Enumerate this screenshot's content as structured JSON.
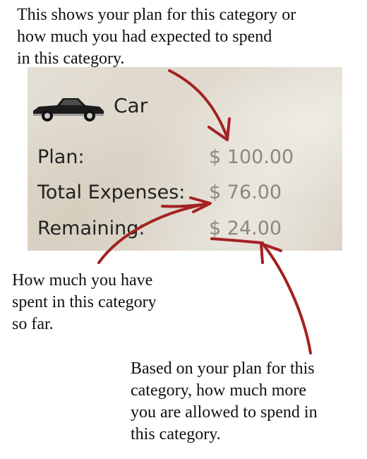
{
  "annotations": {
    "top": "This shows your plan for this category or\nhow much you had expected to spend\nin this category.",
    "left": "How much you have\nspent in this category\nso far.",
    "right": "Based on your plan for this\ncategory, how much more\nyou are allowed to spend in\nthis category."
  },
  "category": {
    "icon": "car-icon",
    "title": "Car"
  },
  "rows": [
    {
      "label": "Plan:",
      "value": "$ 100.00"
    },
    {
      "label": "Total Expenses:",
      "value": "$ 76.00"
    },
    {
      "label": "Remaining:",
      "value": "$ 24.00"
    }
  ],
  "colors": {
    "arrow": "#a32222",
    "value_text": "#8a8782",
    "panel_bg": "#e2ddd3"
  }
}
